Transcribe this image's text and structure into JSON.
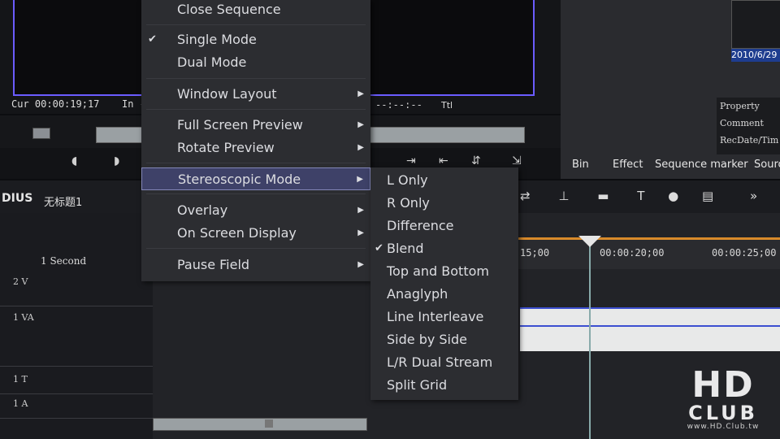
{
  "monitor": {
    "cur_label": "Cur",
    "cur_timecode": "00:00:19;17",
    "in_label": "In",
    "in_timecode": "-",
    "out_timecode": "--:--:--",
    "ttl_label": "Ttl"
  },
  "right_panel": {
    "thumb_date": "2010/6/29",
    "properties": [
      "Property",
      "Comment",
      "RecDate/Tim"
    ],
    "tabs": [
      "Bin",
      "Effect",
      "Sequence marker",
      "Sourc"
    ]
  },
  "timeline": {
    "app_title": "DIUS",
    "sequence_name": "无标题1",
    "scale": "1 Second",
    "ruler": [
      "15;00",
      "00:00:20;00",
      "00:00:25;00"
    ],
    "tracks": [
      "2 V",
      "1 VA",
      "1 T",
      "1 A"
    ]
  },
  "menu": {
    "items": [
      {
        "label": "Close Sequence",
        "checked": false,
        "submenu": false
      },
      {
        "label": "Single Mode",
        "checked": true,
        "submenu": false
      },
      {
        "label": "Dual Mode",
        "checked": false,
        "submenu": false
      },
      {
        "label": "Window Layout",
        "checked": false,
        "submenu": true
      },
      {
        "label": "Full Screen Preview",
        "checked": false,
        "submenu": true
      },
      {
        "label": "Rotate Preview",
        "checked": false,
        "submenu": true
      },
      {
        "label": "Stereoscopic Mode",
        "checked": false,
        "submenu": true
      },
      {
        "label": "Overlay",
        "checked": false,
        "submenu": true
      },
      {
        "label": "On Screen Display",
        "checked": false,
        "submenu": true
      },
      {
        "label": "Pause Field",
        "checked": false,
        "submenu": true
      }
    ],
    "check_glyph": "✔",
    "arrow_glyph": "▶"
  },
  "submenu": {
    "items": [
      {
        "label": "L Only",
        "checked": false
      },
      {
        "label": "R Only",
        "checked": false
      },
      {
        "label": "Difference",
        "checked": false
      },
      {
        "label": "Blend",
        "checked": true
      },
      {
        "label": "Top and Bottom",
        "checked": false
      },
      {
        "label": "Anaglyph",
        "checked": false
      },
      {
        "label": "Line Interleave",
        "checked": false
      },
      {
        "label": "Side by Side",
        "checked": false
      },
      {
        "label": "L/R Dual Stream",
        "checked": false
      },
      {
        "label": "Split Grid",
        "checked": false
      }
    ]
  },
  "watermark": {
    "main": "HD",
    "sub": "CLUB",
    "url": "www.HD.Club.tw"
  }
}
